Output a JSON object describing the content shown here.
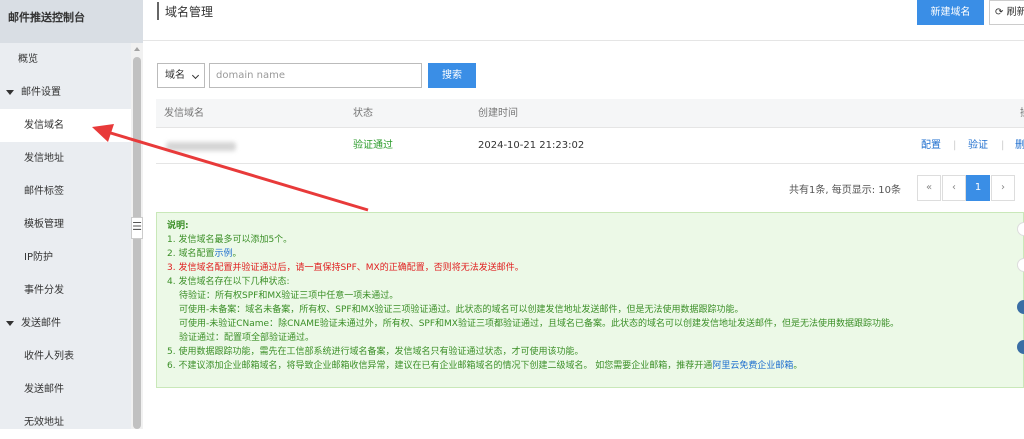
{
  "sidebar": {
    "brand": "邮件推送控制台",
    "items": [
      {
        "label": "概览"
      },
      {
        "label": "邮件设置",
        "group": true
      },
      {
        "label": "发信域名",
        "active": true
      },
      {
        "label": "发信地址"
      },
      {
        "label": "邮件标签"
      },
      {
        "label": "模板管理"
      },
      {
        "label": "IP防护"
      },
      {
        "label": "事件分发"
      },
      {
        "label": "发送邮件",
        "group": true
      },
      {
        "label": "收件人列表"
      },
      {
        "label": "发送邮件"
      },
      {
        "label": "无效地址"
      }
    ]
  },
  "header": {
    "title": "域名管理",
    "new_button": "新建域名",
    "refresh_button": "刷新"
  },
  "filter": {
    "select_value": "域名",
    "search_placeholder": "domain name",
    "search_button": "搜索"
  },
  "table": {
    "columns": [
      "发信域名",
      "状态",
      "创建时间",
      "操"
    ],
    "rows": [
      {
        "domain": "",
        "status": "验证通过",
        "created": "2024-10-21 21:23:02",
        "actions": [
          "配置",
          "验证",
          "删"
        ]
      }
    ]
  },
  "pagination": {
    "summary": "共有1条, 每页显示: 10条",
    "first": "«",
    "prev": "‹",
    "current": "1",
    "next": "›"
  },
  "notice": {
    "title": "说明:",
    "line1": "1. 发信域名最多可以添加5个。",
    "line2_prefix": "2. 域名配置",
    "line2_link": "示例",
    "line2_suffix": "。",
    "line3": "3. 发信域名配置并验证通过后，请一直保持SPF、MX的正确配置，否则将无法发送邮件。",
    "line4": "4. 发信域名存在以下几种状态:",
    "line4a": "待验证：所有权SPF和MX验证三项中任意一项未通过。",
    "line4b": "可使用-未备案：域名未备案，所有权、SPF和MX验证三项验证通过。此状态的域名可以创建发信地址发送邮件，但是无法使用数据跟踪功能。",
    "line4c": "可使用-未验证CName：除CNAME验证未通过外，所有权、SPF和MX验证三项都验证通过，且域名已备案。此状态的域名可以创建发信地址发送邮件，但是无法使用数据跟踪功能。",
    "line4d": "验证通过：配置项全部验证通过。",
    "line5": "5. 使用数据跟踪功能，需先在工信部系统进行域名备案，发信域名只有验证通过状态，才可使用该功能。",
    "line6_prefix": "6. 不建议添加企业邮箱域名，将导致企业邮箱收信异常，建议在已有企业邮箱域名的情况下创建二级域名。 如您需要企业邮箱，推荐开通",
    "line6_link": "阿里云免费企业邮箱",
    "line6_suffix": "。"
  },
  "colors": {
    "primary": "#3a8ee6",
    "success": "#2b9b2b",
    "warning": "#e02020",
    "annotation_arrow": "#e83a3a"
  }
}
